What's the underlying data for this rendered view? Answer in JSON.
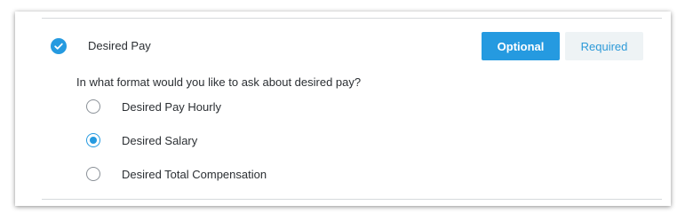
{
  "section": {
    "title": "Desired Pay",
    "completed_icon": "check-circle-icon"
  },
  "requirement_toggle": {
    "options": [
      "Optional",
      "Required"
    ],
    "selected": "Optional"
  },
  "question": {
    "text": "In what format would you like to ask about desired pay?",
    "options": [
      {
        "label": "Desired Pay Hourly",
        "selected": false
      },
      {
        "label": "Desired Salary",
        "selected": true
      },
      {
        "label": "Desired Total Compensation",
        "selected": false
      }
    ]
  },
  "colors": {
    "accent": "#259ae0",
    "required_bg": "#eef3f5",
    "text": "#2b2f33",
    "divider": "#d6d9dc"
  }
}
